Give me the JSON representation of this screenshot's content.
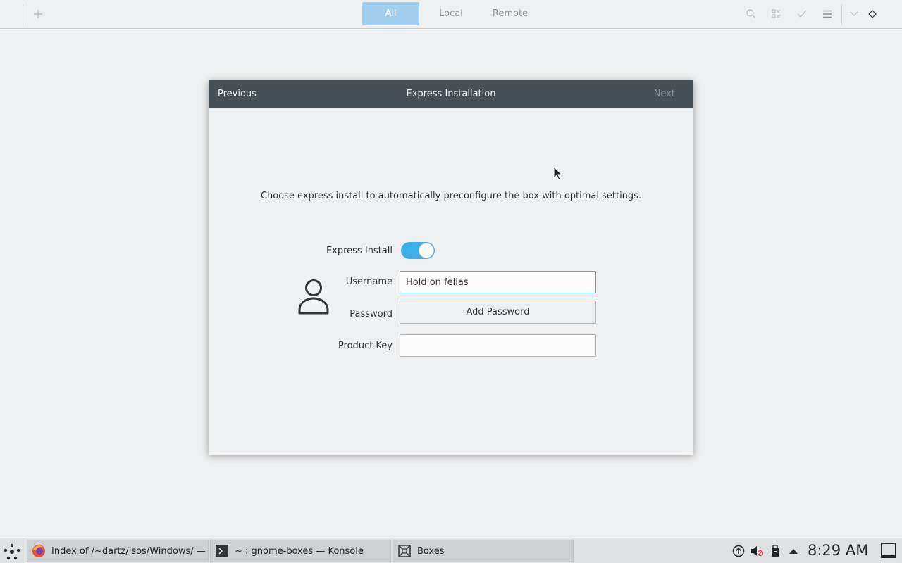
{
  "header": {
    "new_icon": "plus-icon",
    "view_tabs": [
      {
        "label": "All",
        "active": true
      },
      {
        "label": "Local",
        "active": false
      },
      {
        "label": "Remote",
        "active": false
      }
    ],
    "right_icons": [
      "search-icon",
      "list-view-icon",
      "select-check-icon",
      "menu-icon",
      "minimize-icon",
      "maximize-icon"
    ]
  },
  "dialog": {
    "previous_label": "Previous",
    "title": "Express Installation",
    "next_label": "Next",
    "intro_text": "Choose express install to automatically preconfigure the box with optimal settings.",
    "express_install_label": "Express Install",
    "express_install_enabled": true,
    "username_label": "Username",
    "username_value": "Hold on fellas",
    "password_label": "Password",
    "add_password_label": "Add Password",
    "product_key_label": "Product Key",
    "product_key_value": ""
  },
  "taskbar": {
    "tasks": [
      {
        "label": "Index of /~dartz/isos/Windows/ — ...",
        "icon": "firefox-icon"
      },
      {
        "label": "~ : gnome-boxes — Konsole",
        "icon": "terminal-icon"
      },
      {
        "label": "Boxes",
        "icon": "boxes-icon"
      }
    ],
    "tray_icons": [
      "updates-icon",
      "volume-muted-icon",
      "usb-device-icon",
      "expand-tray-icon"
    ],
    "clock": "8:29 AM"
  },
  "colors": {
    "accent": "#3daee9",
    "active_tab": "#a2cfee",
    "dialog_header": "#475057",
    "background": "#eff0f1"
  }
}
